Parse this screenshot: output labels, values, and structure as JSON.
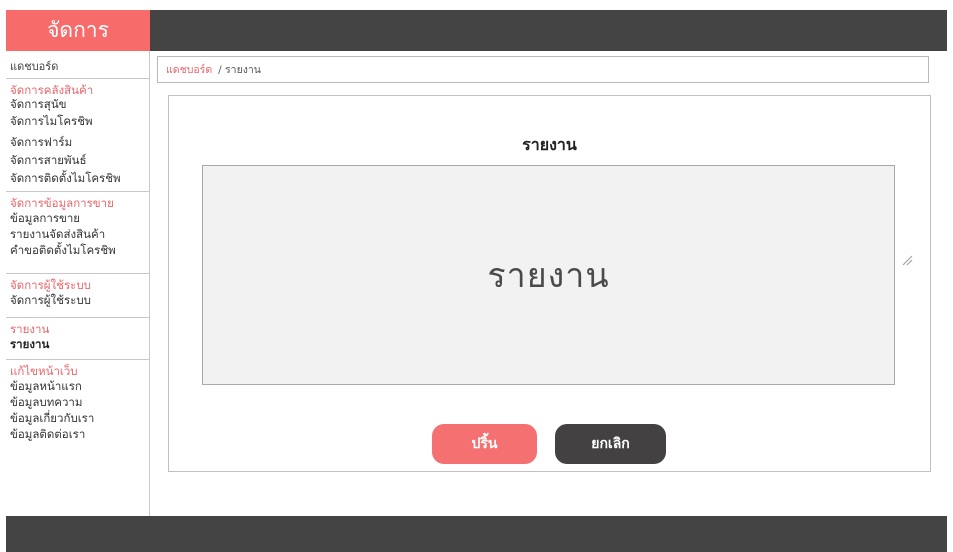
{
  "app": {
    "title": "จัดการ"
  },
  "sidebar": {
    "dashboard": "แดชบอร์ด",
    "groups": [
      {
        "title": "จัดการคลังสินค้า",
        "items": [
          "จัดการสุนัข",
          "จัดการไมโครชิพ",
          "จัดการฟาร์ม",
          "จัดการสายพันธ์",
          "จัดการติดตั้งไมโครชิพ"
        ]
      },
      {
        "title": "จัดการข้อมูลการขาย",
        "items": [
          "ข้อมูลการขาย",
          "รายงานจัดส่งสินค้า",
          "คำขอติดตั้งไมโครชิพ"
        ]
      },
      {
        "title": "จัดการผู้ใช้ระบบ",
        "items": [
          "จัดการผู้ใช้ระบบ"
        ]
      },
      {
        "title": "รายงาน",
        "items": [
          "รายงาน"
        ]
      },
      {
        "title": "แก้ไขหน้าเว็บ",
        "items": [
          "ข้อมูลหน้าแรก",
          "ข้อมูลบทความ",
          "ข้อมูลเกี่ยวกับเรา",
          "ข้อมูลติดต่อเรา"
        ]
      }
    ]
  },
  "breadcrumb": {
    "home": "แดชบอร์ด",
    "current": "/ รายงาน"
  },
  "main": {
    "title": "รายงาน",
    "report_area_text": "รายงาน",
    "print_label": "ปริ้น",
    "cancel_label": "ยกเลิก"
  },
  "colors": {
    "accent": "#f76b6b",
    "dark": "#444444",
    "button_print": "#f47071",
    "button_cancel": "#434141"
  },
  "icons": {
    "resize": "resize-grip-icon"
  }
}
